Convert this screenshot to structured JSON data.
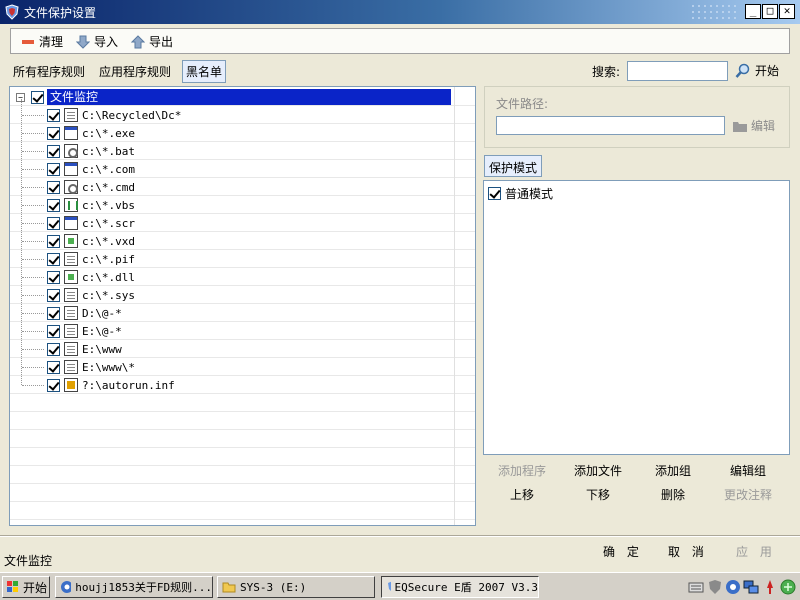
{
  "window": {
    "title": "文件保护设置",
    "controls": {
      "minimize": "_",
      "maximize": "□",
      "close": "✕"
    }
  },
  "toolbar": {
    "items": [
      {
        "label": "清理",
        "icon": "minus-icon"
      },
      {
        "label": "导入",
        "icon": "arrow-down-icon"
      },
      {
        "label": "导出",
        "icon": "arrow-up-icon"
      }
    ]
  },
  "tabs": [
    {
      "label": "所有程序规则",
      "active": false
    },
    {
      "label": "应用程序规则",
      "active": false
    },
    {
      "label": "黑名单",
      "active": true
    }
  ],
  "search": {
    "label": "搜索:",
    "value": "",
    "button": "开始"
  },
  "tree": {
    "root": {
      "label": "文件监控",
      "checked": true,
      "expanded": true,
      "expander": "−"
    },
    "items": [
      {
        "label": "C:\\Recycled\\Dc*",
        "icon": "doc",
        "checked": true
      },
      {
        "label": "c:\\*.exe",
        "icon": "win",
        "checked": true
      },
      {
        "label": "c:\\*.bat",
        "icon": "gear",
        "checked": true
      },
      {
        "label": "c:\\*.com",
        "icon": "win",
        "checked": true
      },
      {
        "label": "c:\\*.cmd",
        "icon": "gear",
        "checked": true
      },
      {
        "label": "c:\\*.vbs",
        "icon": "script",
        "checked": true
      },
      {
        "label": "c:\\*.scr",
        "icon": "win",
        "checked": true
      },
      {
        "label": "c:\\*.vxd",
        "icon": "green",
        "checked": true
      },
      {
        "label": "c:\\*.pif",
        "icon": "doc",
        "checked": true
      },
      {
        "label": "c:\\*.dll",
        "icon": "green",
        "checked": true
      },
      {
        "label": "c:\\*.sys",
        "icon": "doc",
        "checked": true
      },
      {
        "label": "D:\\@-*",
        "icon": "doc",
        "checked": true
      },
      {
        "label": "E:\\@-*",
        "icon": "doc",
        "checked": true
      },
      {
        "label": "E:\\www",
        "icon": "doc",
        "checked": true
      },
      {
        "label": "E:\\www\\*",
        "icon": "doc",
        "checked": true
      },
      {
        "label": "?:\\autorun.inf",
        "icon": "flag",
        "checked": true
      }
    ]
  },
  "path": {
    "label": "文件路径:",
    "value": "",
    "edit_button": "编辑"
  },
  "mode": {
    "tab_label": "保护模式",
    "items": [
      {
        "label": "普通模式",
        "checked": true
      }
    ]
  },
  "actions": {
    "add_program": "添加程序",
    "add_file": "添加文件",
    "add_group": "添加组",
    "edit_group": "编辑组",
    "move_up": "上移",
    "move_down": "下移",
    "delete": "删除",
    "change_note": "更改注释"
  },
  "status": {
    "text": "文件监控"
  },
  "buttons": {
    "ok": "确 定",
    "cancel": "取 消",
    "apply": "应 用"
  },
  "taskbar": {
    "start": "开始",
    "tasks": [
      {
        "label": "houjj1853关于FD规则...",
        "active": false
      },
      {
        "label": "SYS-3 (E:)",
        "active": false
      },
      {
        "label": "EQSecure E盾 2007 V3.3",
        "active": true
      }
    ]
  },
  "colors": {
    "title_start": "#0a246a",
    "title_end": "#a6caf0",
    "selection": "#0a24c8",
    "face": "#ece9d8"
  }
}
